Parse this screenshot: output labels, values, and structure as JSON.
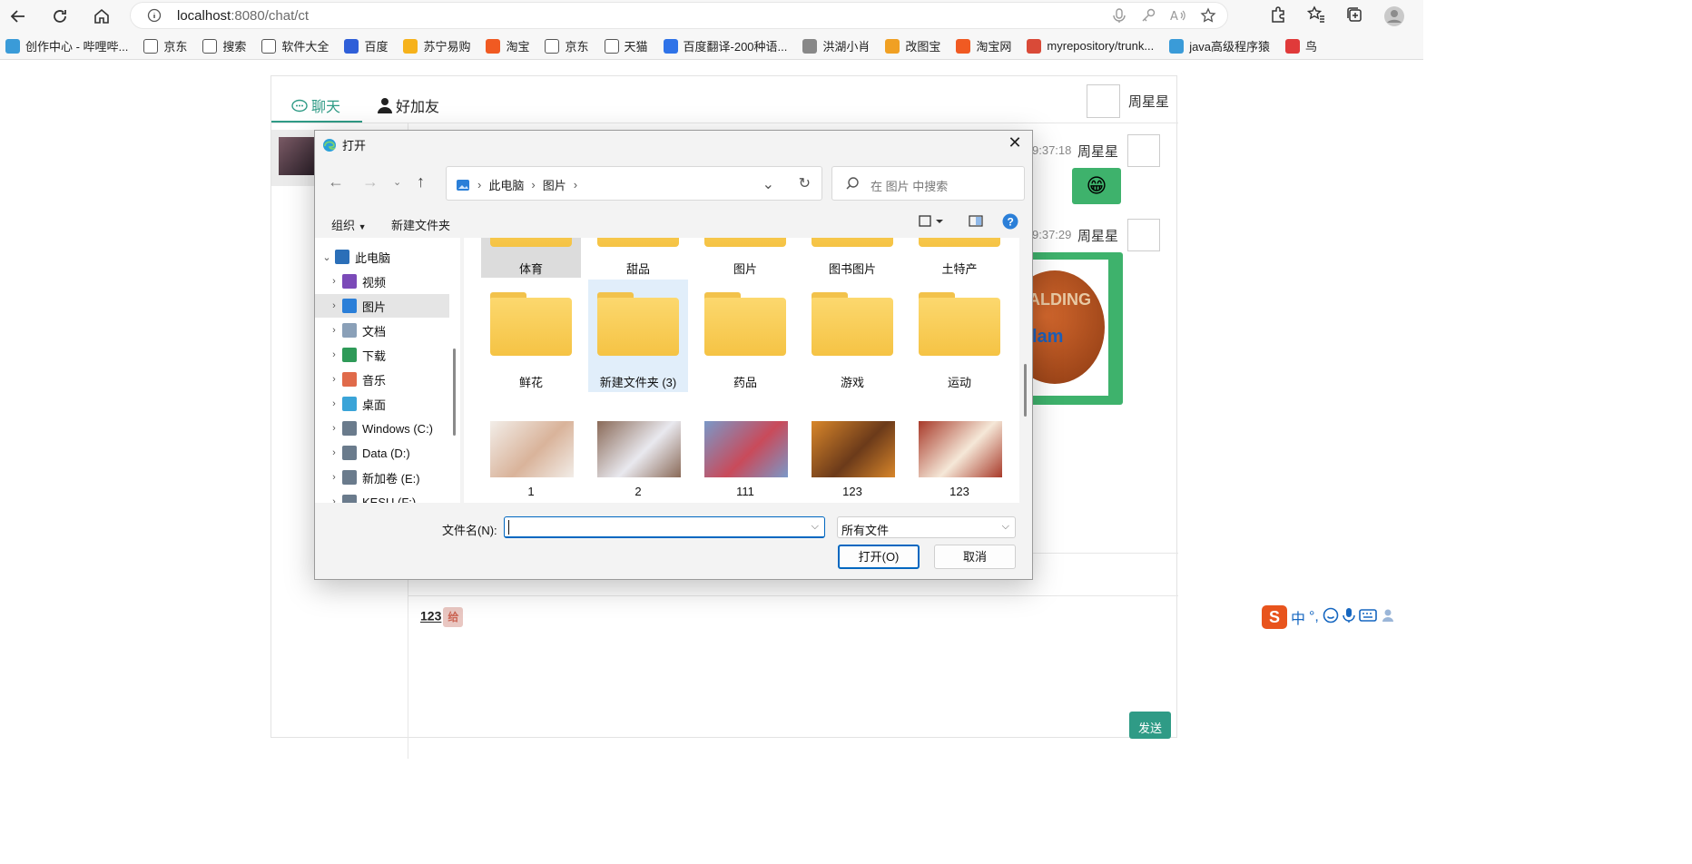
{
  "browser": {
    "url_host": "localhost",
    "url_path": ":8080/chat/ct",
    "bookmarks": [
      {
        "label": "创作中心 - 哔哩哔...",
        "color": "#3a9bd8"
      },
      {
        "label": "京东",
        "color": "#ffffff"
      },
      {
        "label": "搜索",
        "color": "#ffffff"
      },
      {
        "label": "软件大全",
        "color": "#ffffff"
      },
      {
        "label": "百度",
        "color": "#2f5fd8"
      },
      {
        "label": "苏宁易购",
        "color": "#f6b21b"
      },
      {
        "label": "淘宝",
        "color": "#f05a22"
      },
      {
        "label": "京东",
        "color": "#ffffff"
      },
      {
        "label": "天猫",
        "color": "#ffffff"
      },
      {
        "label": "百度翻译-200种语...",
        "color": "#2f73e8"
      },
      {
        "label": "洪湖小肖",
        "color": "#888888"
      },
      {
        "label": "改图宝",
        "color": "#f0a023"
      },
      {
        "label": "淘宝网",
        "color": "#f05a22"
      },
      {
        "label": "myrepository/trunk...",
        "color": "#d94a38"
      },
      {
        "label": "java高级程序猿",
        "color": "#3a9bd8"
      },
      {
        "label": "鸟",
        "color": "#e03a3a"
      }
    ]
  },
  "chat": {
    "tab_chat": "聊天",
    "tab_friend": "好加友",
    "current_user": "周星星",
    "messages": [
      {
        "time": "9:37:18",
        "name": "周星星",
        "emoji": "😁"
      },
      {
        "time": "9:37:29",
        "name": "周星星",
        "image_text_top": "ALDING",
        "image_text_mid": "lam"
      }
    ],
    "draft_text": "123",
    "draft_sticker": "给",
    "send_label": "发送"
  },
  "ime": {
    "logo": "S",
    "mode": "中",
    "punct": "°,"
  },
  "dialog": {
    "title": "打开",
    "breadcrumb": [
      "此电脑",
      "图片"
    ],
    "search_placeholder": "在 图片 中搜索",
    "organize_label": "组织",
    "new_folder_label": "新建文件夹",
    "tree": [
      {
        "label": "此电脑",
        "color": "#2b6fb8",
        "expanded": true
      },
      {
        "label": "视频",
        "color": "#7b4ab8"
      },
      {
        "label": "图片",
        "color": "#2b7fd8",
        "selected": true
      },
      {
        "label": "文档",
        "color": "#8aa0b8"
      },
      {
        "label": "下载",
        "color": "#2e9a58"
      },
      {
        "label": "音乐",
        "color": "#e06a4a"
      },
      {
        "label": "桌面",
        "color": "#3aa4d8"
      },
      {
        "label": "Windows (C:)",
        "color": "#6a7b8c"
      },
      {
        "label": "Data (D:)",
        "color": "#6a7b8c"
      },
      {
        "label": "新加卷 (E:)",
        "color": "#6a7b8c"
      },
      {
        "label": "KESU (F:)",
        "color": "#6a7b8c"
      }
    ],
    "row1": [
      "体育",
      "甜品",
      "图片",
      "图书图片",
      "土特产"
    ],
    "row2": [
      "鲜花",
      "新建文件夹 (3)",
      "药品",
      "游戏",
      "运动"
    ],
    "row3": [
      {
        "label": "1",
        "c1": "#d9b39a",
        "c2": "#f2ede8"
      },
      {
        "label": "2",
        "c1": "#e9e9ef",
        "c2": "#8a6a58"
      },
      {
        "label": "111",
        "c1": "#c94a5a",
        "c2": "#7a98c8"
      },
      {
        "label": "123",
        "c1": "#6b3a1a",
        "c2": "#d8862a"
      },
      {
        "label": "123",
        "c1": "#f5e8d8",
        "c2": "#a83a2a"
      }
    ],
    "filename_label": "文件名(N):",
    "filename_value": "",
    "filetype_value": "所有文件",
    "open_label": "打开(O)",
    "cancel_label": "取消"
  }
}
